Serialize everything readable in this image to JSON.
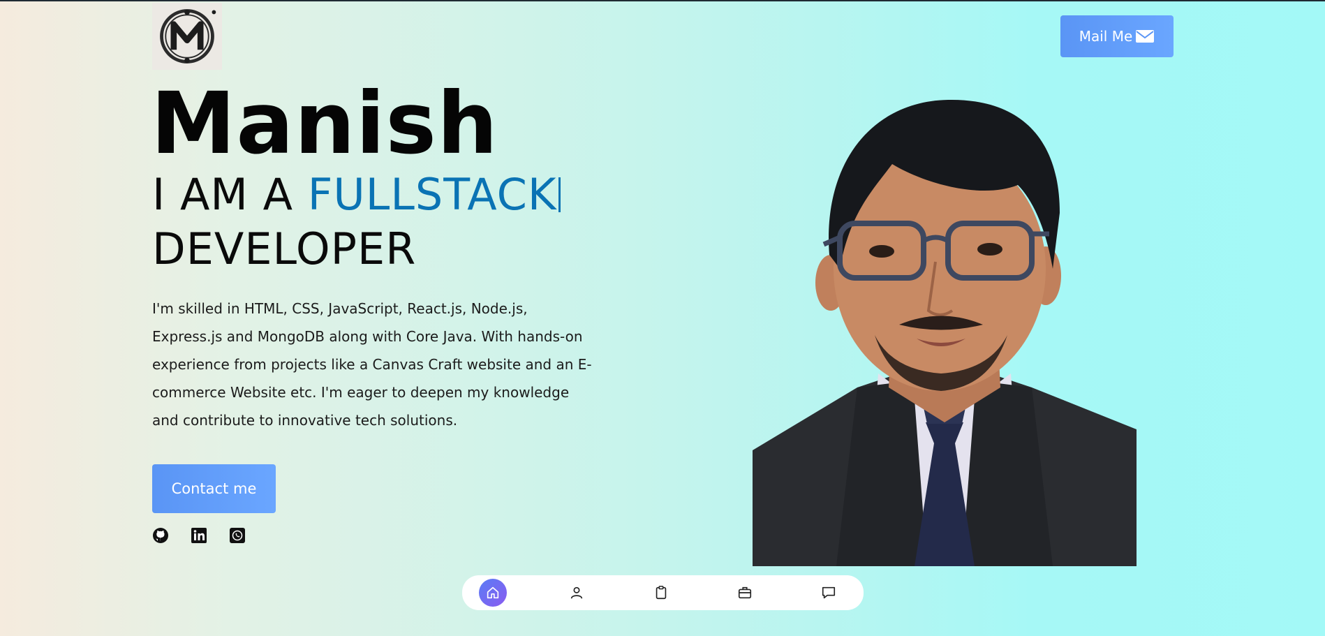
{
  "header": {
    "logo_icon": "monogram-m-logo",
    "mail_button_label": "Mail Me",
    "mail_icon": "envelope-icon"
  },
  "hero": {
    "name": "Manish",
    "role_prefix": "I AM A ",
    "role_highlight": "FULLSTACK",
    "role_suffix": "DEVELOPER",
    "bio": "I'm skilled in HTML, CSS, JavaScript, React.js, Node.js, Express.js and MongoDB along with Core Java. With hands-on experience from projects like a Canvas Craft website and an E-commerce Website etc. I'm eager to deepen my knowledge and contribute to innovative tech solutions.",
    "contact_button_label": "Contact me"
  },
  "socials": [
    "github-icon",
    "linkedin-icon",
    "whatsapp-icon"
  ],
  "nav": {
    "items": [
      "home-icon",
      "user-icon",
      "clipboard-icon",
      "briefcase-icon",
      "message-icon"
    ],
    "active": "home-icon"
  },
  "colors": {
    "accent": "#0a73b4",
    "button": "#5a95f5"
  }
}
